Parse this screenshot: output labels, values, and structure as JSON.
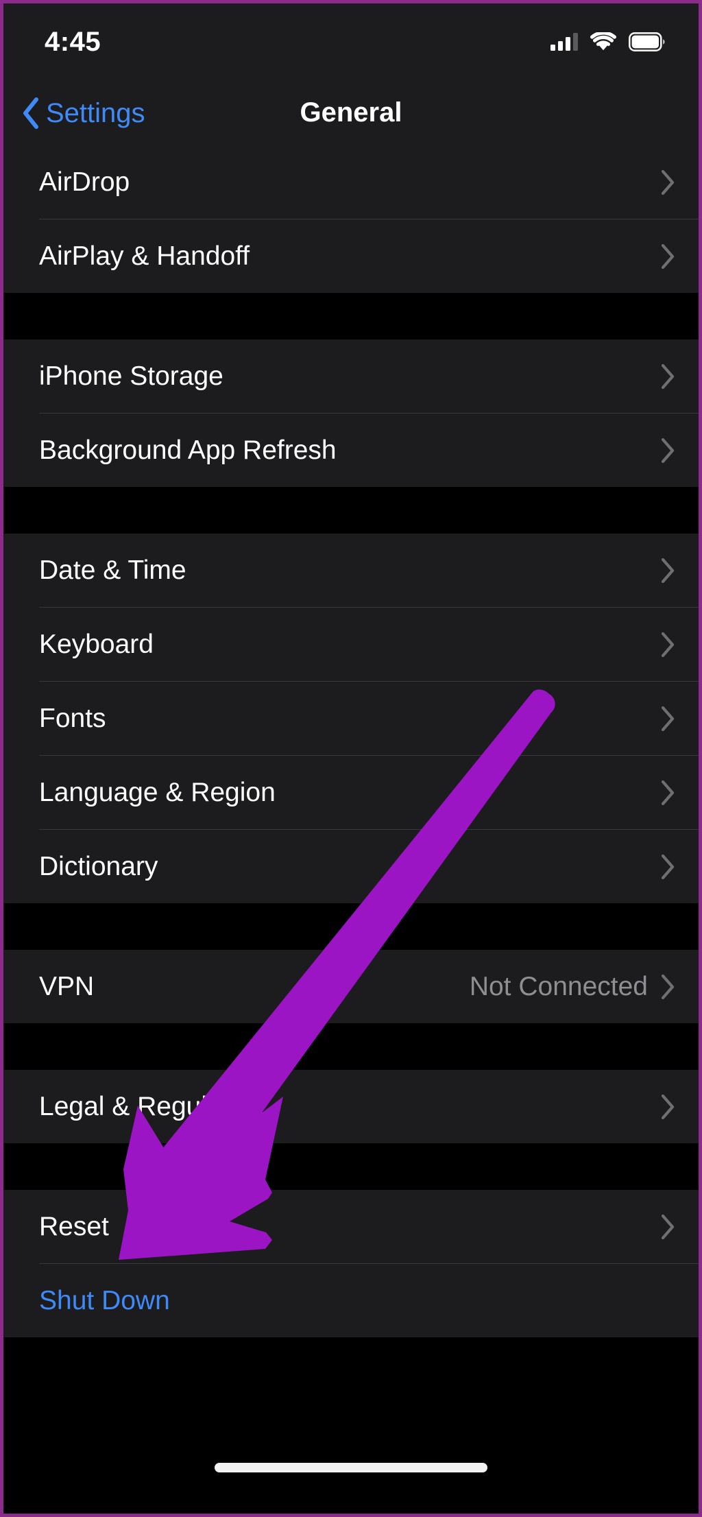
{
  "status_bar": {
    "time": "4:45",
    "cellular_icon": "cellular-signal-icon",
    "cellular_bars_filled": 3,
    "cellular_bars_total": 4,
    "wifi_icon": "wifi-icon",
    "battery_icon": "battery-full-icon",
    "battery_level": "full"
  },
  "nav_bar": {
    "back_icon": "chevron-left-icon",
    "back_label": "Settings",
    "title": "General"
  },
  "annotation": {
    "type": "arrow",
    "color": "#9B15C4",
    "points_to": "Reset",
    "direction": "down-left"
  },
  "colors": {
    "accent_blue": "#3E8AF7",
    "row_background": "#1C1C1E",
    "page_background": "#000000",
    "separator": "#3A3A3C",
    "secondary_text": "#8E8E93",
    "annotation_purple": "#9B15C4",
    "frame_border": "#8B2B8B"
  },
  "groups": [
    {
      "name": "sharing-group",
      "rows": [
        {
          "label": "AirDrop",
          "value": "",
          "chevron": true,
          "style": "default"
        },
        {
          "label": "AirPlay & Handoff",
          "value": "",
          "chevron": true,
          "style": "default"
        }
      ]
    },
    {
      "name": "storage-group",
      "rows": [
        {
          "label": "iPhone Storage",
          "value": "",
          "chevron": true,
          "style": "default"
        },
        {
          "label": "Background App Refresh",
          "value": "",
          "chevron": true,
          "style": "default"
        }
      ]
    },
    {
      "name": "localization-group",
      "rows": [
        {
          "label": "Date & Time",
          "value": "",
          "chevron": true,
          "style": "default"
        },
        {
          "label": "Keyboard",
          "value": "",
          "chevron": true,
          "style": "default"
        },
        {
          "label": "Fonts",
          "value": "",
          "chevron": true,
          "style": "default"
        },
        {
          "label": "Language & Region",
          "value": "",
          "chevron": true,
          "style": "default"
        },
        {
          "label": "Dictionary",
          "value": "",
          "chevron": true,
          "style": "default"
        }
      ]
    },
    {
      "name": "vpn-group",
      "rows": [
        {
          "label": "VPN",
          "value": "Not Connected",
          "chevron": true,
          "style": "default"
        }
      ]
    },
    {
      "name": "legal-group",
      "rows": [
        {
          "label": "Legal & Regulatory",
          "value": "",
          "chevron": true,
          "style": "default"
        }
      ]
    },
    {
      "name": "reset-group",
      "rows": [
        {
          "label": "Reset",
          "value": "",
          "chevron": true,
          "style": "default"
        },
        {
          "label": "Shut Down",
          "value": "",
          "chevron": false,
          "style": "accent"
        }
      ]
    }
  ],
  "home_indicator": {
    "name": "home-indicator"
  }
}
